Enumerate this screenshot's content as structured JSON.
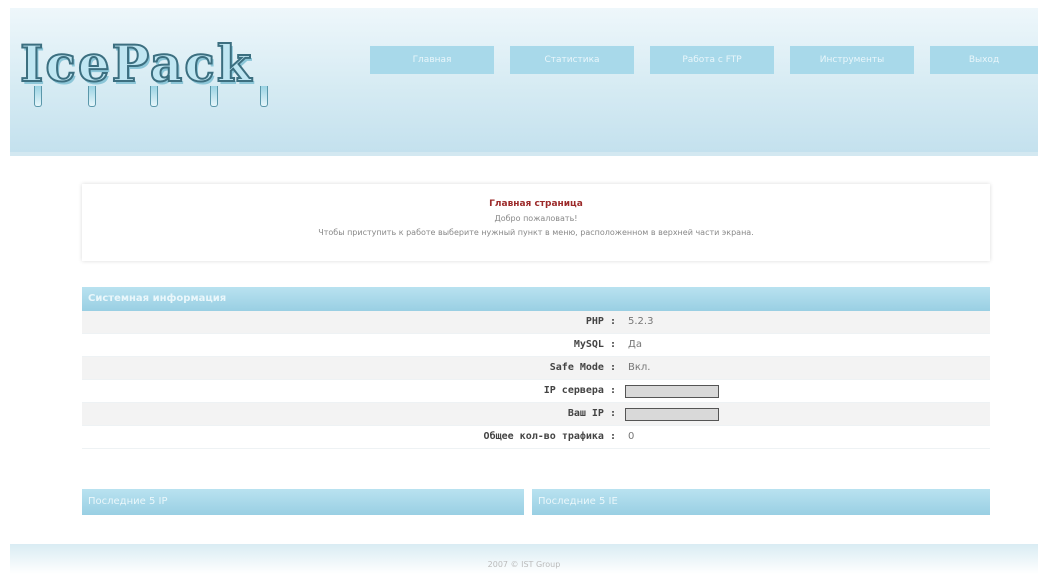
{
  "logo": {
    "text": "IcePack"
  },
  "nav": [
    {
      "label": "Главная"
    },
    {
      "label": "Статистика"
    },
    {
      "label": "Работа с FTP"
    },
    {
      "label": "Инструменты"
    },
    {
      "label": "Выход"
    }
  ],
  "welcome": {
    "title": "Главная страница",
    "greeting": "Добро пожаловать!",
    "instruction": "Чтобы приступить к работе выберите нужный пункт в меню, расположенном в верхней части экрана."
  },
  "system_info": {
    "header": "Системная информация",
    "rows": [
      {
        "label": "PHP :",
        "value": "5.2.3"
      },
      {
        "label": "MySQL :",
        "value": "Да"
      },
      {
        "label": "Safe Mode :",
        "value": "Вкл."
      },
      {
        "label": "IP сервера :",
        "value": ""
      },
      {
        "label": "Ваш IP :",
        "value": ""
      },
      {
        "label": "Общее кол-во трафика :",
        "value": "0"
      }
    ]
  },
  "panels": {
    "last_ip": "Последние 5 IP",
    "last_ie": "Последние 5 IE"
  },
  "footer": {
    "copyright": "2007 © IST Group"
  }
}
